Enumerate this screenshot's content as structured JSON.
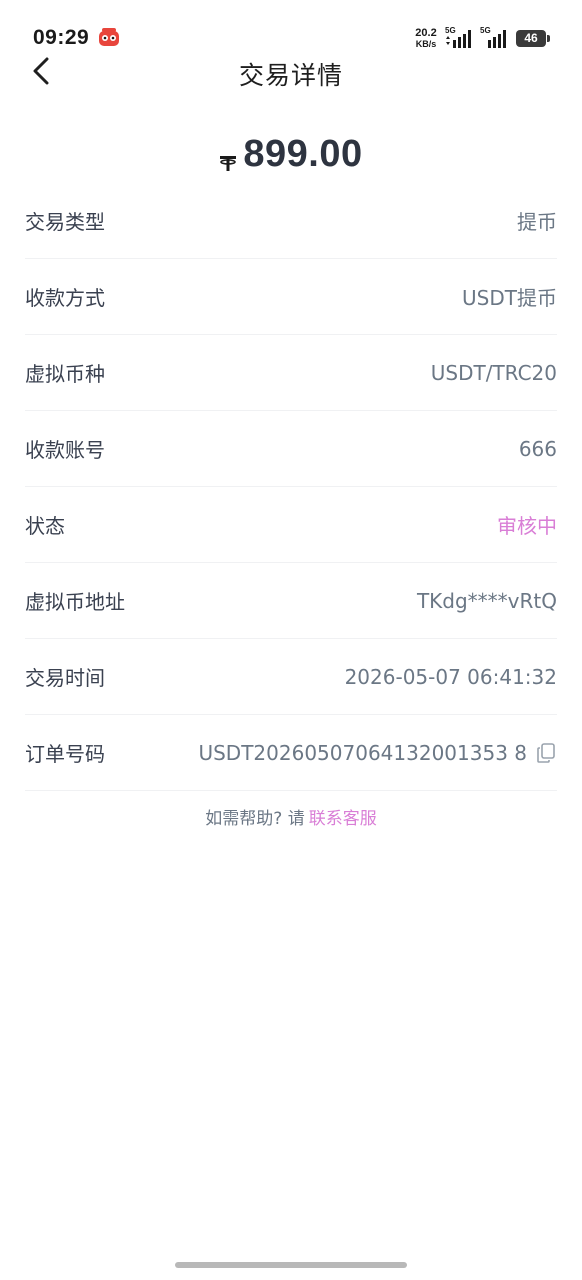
{
  "status_bar": {
    "time": "09:29",
    "net_speed_value": "20.2",
    "net_speed_unit": "KB/s",
    "sim1_label": "5G",
    "sim2_label": "5G",
    "battery": "46"
  },
  "header": {
    "title": "交易详情"
  },
  "amount": {
    "value": "899.00",
    "currency_icon": "tether-icon"
  },
  "details": [
    {
      "label": "交易类型",
      "value": "提币"
    },
    {
      "label": "收款方式",
      "value": "USDT提币"
    },
    {
      "label": "虚拟币种",
      "value": "USDT/TRC20"
    },
    {
      "label": "收款账号",
      "value": "666"
    },
    {
      "label": "状态",
      "value": "审核中"
    },
    {
      "label": "虚拟币地址",
      "value": "TKdg****vRtQ"
    },
    {
      "label": "交易时间",
      "value": "2026-05-07 06:41:32"
    },
    {
      "label": "订单号码",
      "value": "USDT20260507064132001353 8"
    }
  ],
  "help": {
    "prefix": "如需帮助? 请",
    "link": "联系客服"
  },
  "colors": {
    "accent": "#d97ed6",
    "label": "#3a4150",
    "value": "#6b7785"
  }
}
